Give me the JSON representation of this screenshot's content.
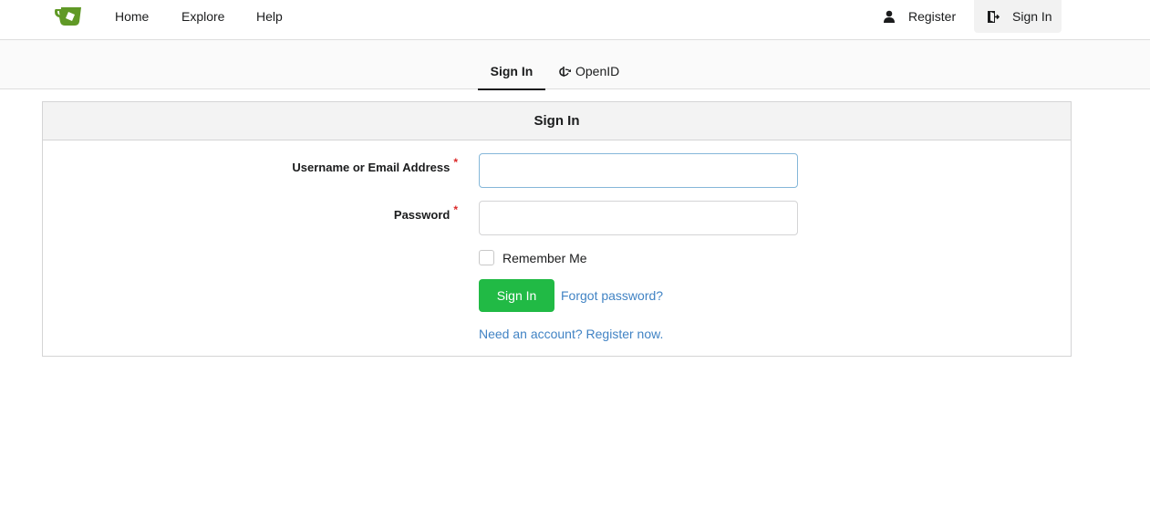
{
  "nav": {
    "logo_icon": "gitea-teacup-logo",
    "home": "Home",
    "explore": "Explore",
    "help": "Help",
    "register": "Register",
    "register_icon": "person-icon",
    "sign_in": "Sign In",
    "sign_in_icon": "sign-in-icon"
  },
  "tabs": [
    {
      "label": "Sign In",
      "active": true
    },
    {
      "label": "OpenID",
      "active": false,
      "icon": "openid-icon"
    }
  ],
  "form": {
    "header": "Sign In",
    "username_label": "Username or Email Address",
    "password_label": "Password",
    "required_marker": "*",
    "username_value": "",
    "password_value": "",
    "remember_label": "Remember Me",
    "remember_checked": false,
    "submit_label": "Sign In",
    "forgot_label": "Forgot password?",
    "register_link": "Need an account? Register now."
  },
  "colors": {
    "primary_button": "#21ba45",
    "link": "#4183c4",
    "logo": "#609926",
    "required": "#db2828"
  }
}
